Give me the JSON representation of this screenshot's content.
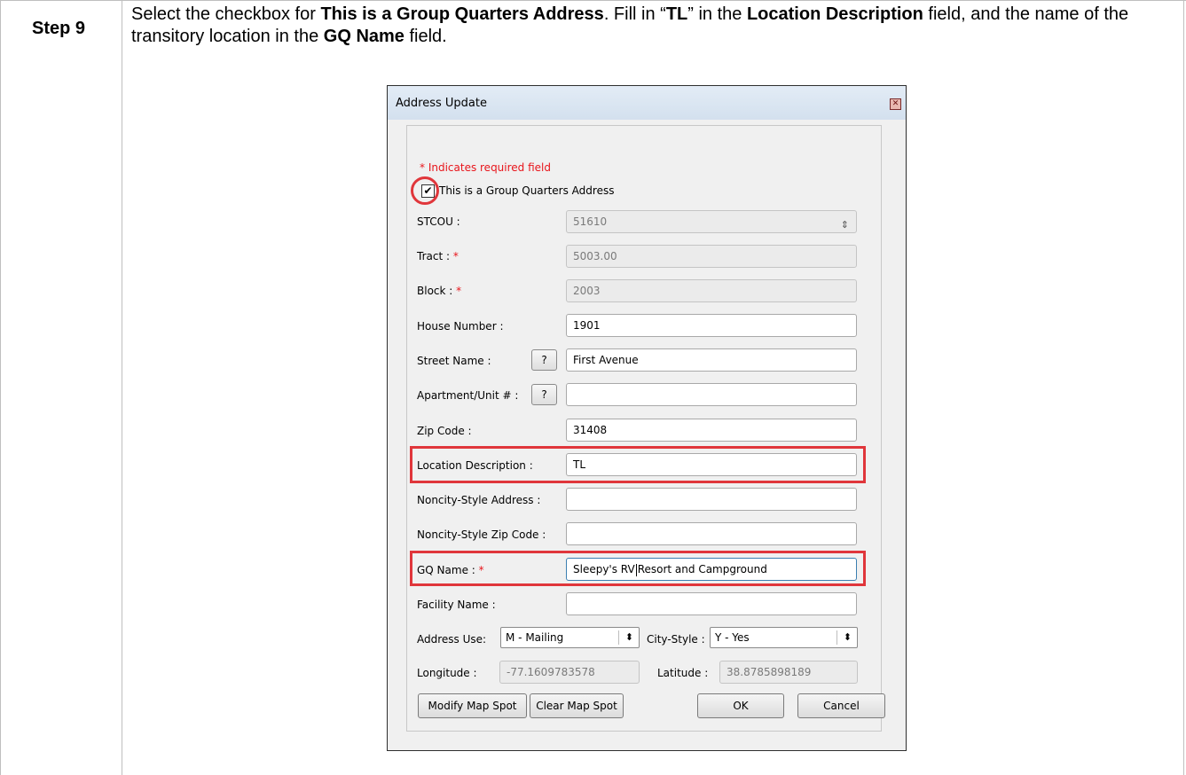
{
  "step": {
    "label": "Step 9"
  },
  "instruction": {
    "p1": "Select the checkbox for ",
    "b1": "This is a Group Quarters Address",
    "p2": ". Fill in “",
    "b2": "TL",
    "p3": "” in the ",
    "b3": "Location Description",
    "p4": " field, and the name of the transitory location in the ",
    "b4": "GQ Name",
    "p5": " field."
  },
  "dialog": {
    "title": "Address Update",
    "close_glyph": "✕",
    "required_note": "* Indicates required field",
    "gq_checkbox": {
      "label": "This is a Group Quarters Address",
      "checked": true,
      "mark": "✔"
    },
    "required_star": "*",
    "fields": {
      "stcou": {
        "label": "STCOU :",
        "value": "51610",
        "spin": "⇕"
      },
      "tract": {
        "label": "Tract :",
        "value": "5003.00"
      },
      "block": {
        "label": "Block :",
        "value": "2003"
      },
      "house_number": {
        "label": "House Number :",
        "value": "1901"
      },
      "street_name": {
        "label": "Street Name :",
        "value": "First Avenue",
        "help": "?"
      },
      "apartment": {
        "label": "Apartment/Unit # :",
        "value": "",
        "help": "?"
      },
      "zip": {
        "label": "Zip Code :",
        "value": "31408"
      },
      "location_description": {
        "label": "Location Description :",
        "value": "TL"
      },
      "noncity_address": {
        "label": "Noncity-Style Address :",
        "value": ""
      },
      "noncity_zip": {
        "label": "Noncity-Style Zip Code :",
        "value": ""
      },
      "gq_name": {
        "label": "GQ Name :",
        "value_before_caret": "Sleepy's RV",
        "value_after_caret": "Resort and Campground"
      },
      "facility_name": {
        "label": "Facility Name :",
        "value": ""
      },
      "address_use": {
        "label": "Address Use:",
        "value": "M - Mailing"
      },
      "city_style": {
        "label": "City-Style :",
        "value": "Y - Yes"
      },
      "longitude": {
        "label": "Longitude :",
        "value": "-77.1609783578"
      },
      "latitude": {
        "label": "Latitude :",
        "value": "38.8785898189"
      }
    },
    "select_arrows": "⬍",
    "buttons": {
      "modify_map_spot": "Modify Map Spot",
      "clear_map_spot": "Clear Map Spot",
      "ok": "OK",
      "cancel": "Cancel"
    },
    "highlight_color": "#e0363b",
    "required_color": "#e8151b"
  }
}
